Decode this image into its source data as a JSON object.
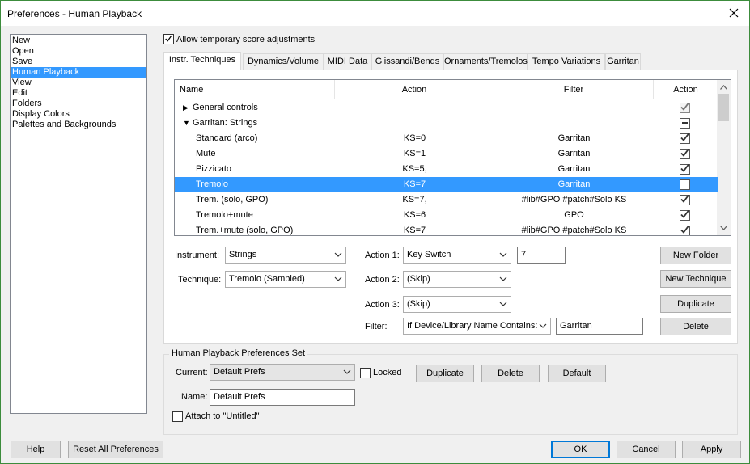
{
  "window": {
    "title": "Preferences - Human Playback"
  },
  "categories": [
    "New",
    "Open",
    "Save",
    "Human Playback",
    "View",
    "Edit",
    "Folders",
    "Display Colors",
    "Palettes and Backgrounds"
  ],
  "allow_temp": {
    "label": "Allow temporary score adjustments",
    "checked": true
  },
  "tabs": [
    "Instr. Techniques",
    "Dynamics/Volume",
    "MIDI Data",
    "Glissandi/Bends",
    "Ornaments/Tremolos",
    "Tempo Variations",
    "Garritan"
  ],
  "table": {
    "headers": [
      "Name",
      "Action",
      "Filter",
      "Action"
    ],
    "rows": [
      {
        "expander": "▶",
        "name": "General controls",
        "action": "",
        "filter": "",
        "state": "checked-disabled"
      },
      {
        "expander": "▼",
        "name": "Garritan: Strings",
        "action": "",
        "filter": "",
        "state": "indeterminate"
      },
      {
        "expander": "",
        "name": "Standard (arco)",
        "action": "KS=0",
        "filter": "Garritan",
        "state": "checked"
      },
      {
        "expander": "",
        "name": "Mute",
        "action": "KS=1",
        "filter": "Garritan",
        "state": "checked"
      },
      {
        "expander": "",
        "name": "Pizzicato",
        "action": "KS=5,",
        "filter": "Garritan",
        "state": "checked"
      },
      {
        "expander": "",
        "name": "Tremolo",
        "action": "KS=7",
        "filter": "Garritan",
        "state": "unchecked",
        "selected": true
      },
      {
        "expander": "",
        "name": "Trem. (solo, GPO)",
        "action": "KS=7,",
        "filter": "#lib#GPO #patch#Solo KS",
        "state": "checked"
      },
      {
        "expander": "",
        "name": "Tremolo+mute",
        "action": "KS=6",
        "filter": "GPO",
        "state": "checked"
      },
      {
        "expander": "",
        "name": "Trem.+mute (solo, GPO)",
        "action": "KS=7",
        "filter": "#lib#GPO #patch#Solo KS",
        "state": "checked"
      }
    ]
  },
  "form": {
    "instrument_label": "Instrument:",
    "instrument_value": "Strings",
    "technique_label": "Technique:",
    "technique_value": "Tremolo (Sampled)",
    "action1_label": "Action 1:",
    "action1_value": "Key Switch",
    "action1_param": "7",
    "action2_label": "Action 2:",
    "action2_value": "(Skip)",
    "action3_label": "Action 3:",
    "action3_value": "(Skip)",
    "filter_label": "Filter:",
    "filter_value": "If Device/Library Name Contains:",
    "filter_text": "Garritan"
  },
  "right_buttons": [
    "New Folder",
    "New Technique",
    "Duplicate",
    "Delete"
  ],
  "prefs_set": {
    "legend": "Human Playback Preferences Set",
    "current_label": "Current:",
    "current_value": "Default Prefs",
    "locked_label": "Locked",
    "duplicate": "Duplicate",
    "delete": "Delete",
    "default": "Default",
    "name_label": "Name:",
    "name_value": "Default Prefs",
    "attach_label": "Attach to \"Untitled\""
  },
  "footer": {
    "help": "Help",
    "reset": "Reset All Preferences",
    "ok": "OK",
    "cancel": "Cancel",
    "apply": "Apply"
  },
  "colors": {
    "selection": "#3399ff",
    "default_button_border": "#0078d7"
  }
}
